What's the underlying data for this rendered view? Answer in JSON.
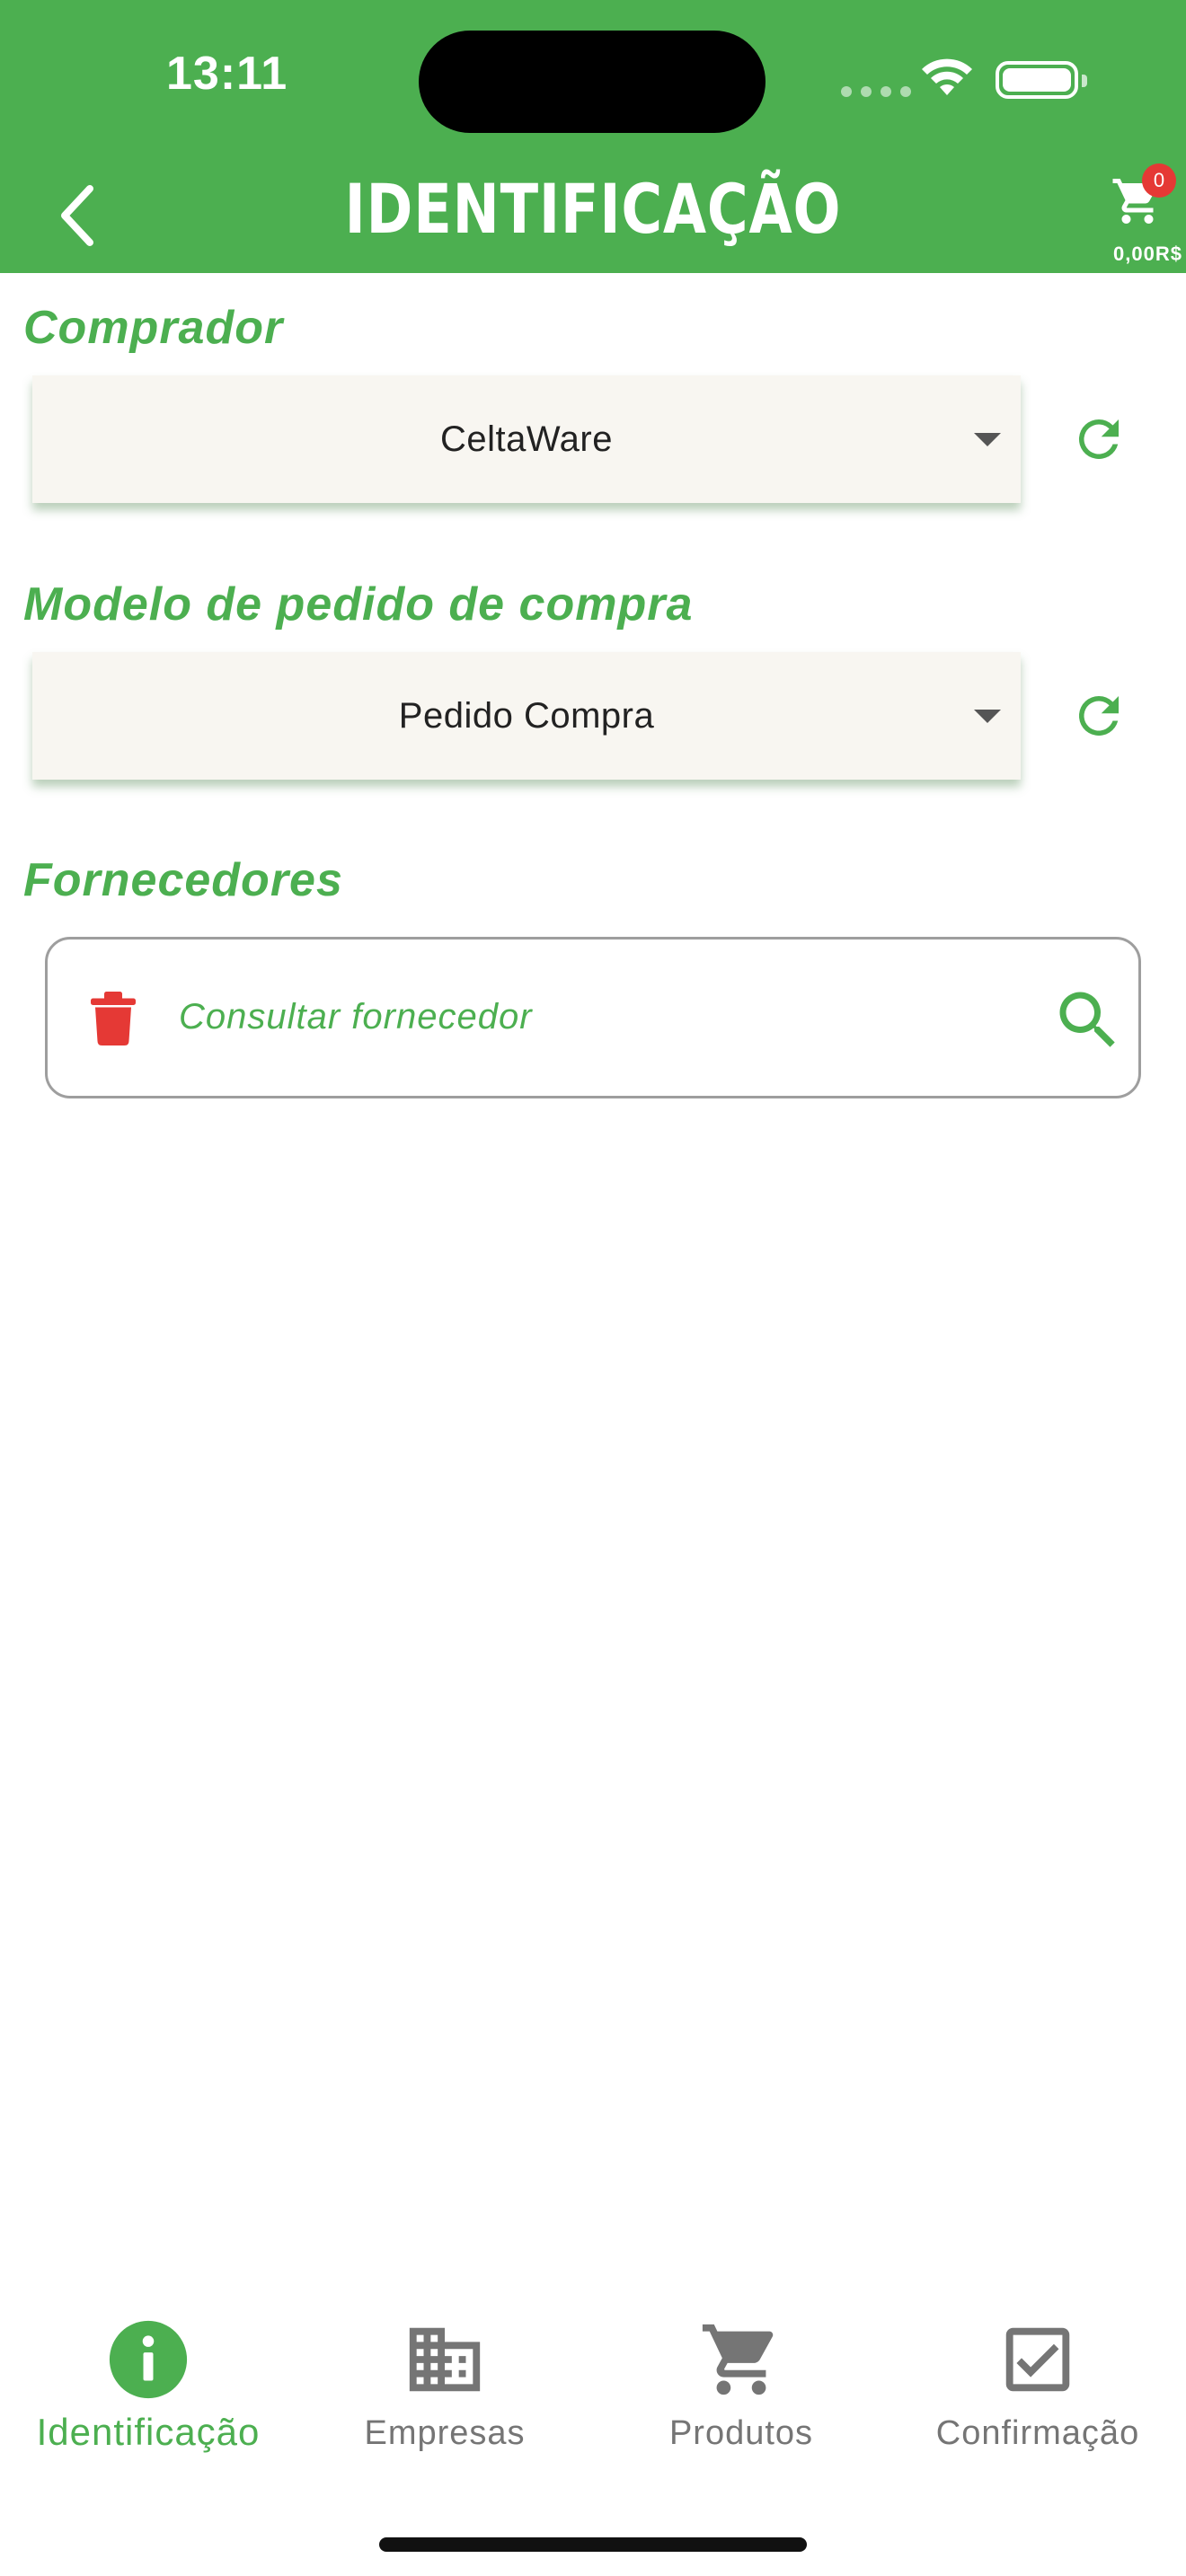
{
  "status": {
    "time": "13:11"
  },
  "header": {
    "title": "IDENTIFICAÇÃO",
    "cart_count": "0",
    "cart_total": "0,00R$"
  },
  "sections": {
    "buyer": {
      "label": "Comprador",
      "selected": "CeltaWare"
    },
    "order_model": {
      "label": "Modelo de pedido de compra",
      "selected": "Pedido Compra"
    },
    "suppliers": {
      "label": "Fornecedores",
      "search_placeholder": "Consultar fornecedor"
    }
  },
  "tabs": [
    {
      "label": "Identificação",
      "icon": "info-icon",
      "active": true
    },
    {
      "label": "Empresas",
      "icon": "building-icon",
      "active": false
    },
    {
      "label": "Produtos",
      "icon": "cart-icon",
      "active": false
    },
    {
      "label": "Confirmação",
      "icon": "check-box-icon",
      "active": false
    }
  ],
  "colors": {
    "primary": "#4caf50",
    "danger": "#e53935",
    "muted": "#757575",
    "dropdown_bg": "#f8f6f1"
  }
}
